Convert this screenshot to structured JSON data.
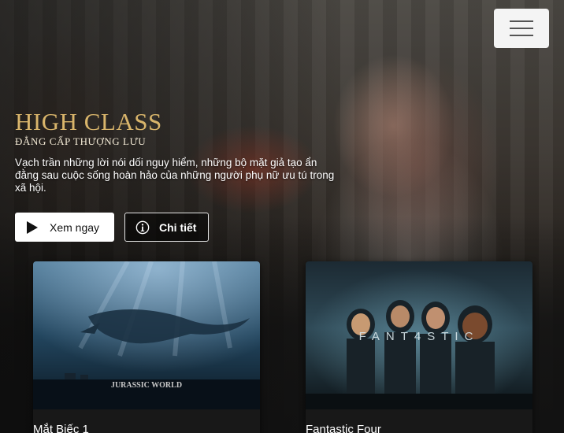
{
  "hero": {
    "logo_title": "HIGH CLASS",
    "logo_subtitle": "ĐẲNG CẤP THƯỢNG LƯU",
    "description": "Vạch trần những lời nói dối nguy hiểm, những bộ mặt giả tạo ẩn đằng sau cuộc sống hoàn hảo của những người phụ nữ ưu tú trong xã hội.",
    "watch_button_label": "Xem ngay",
    "detail_button_label": "Chi tiết"
  },
  "cards": [
    {
      "title": "Mắt Biếc 1",
      "poster_text": "JURASSIC WORLD"
    },
    {
      "title": "Fantastic Four",
      "poster_text": "FANT4STIC"
    }
  ],
  "icons": {
    "menu": "hamburger-menu-icon",
    "watch": "play-icon",
    "detail": "info-icon"
  },
  "colors": {
    "logo_gold": "#d9b56b",
    "button_bg": "#ffffff",
    "page_bg": "#121212"
  }
}
